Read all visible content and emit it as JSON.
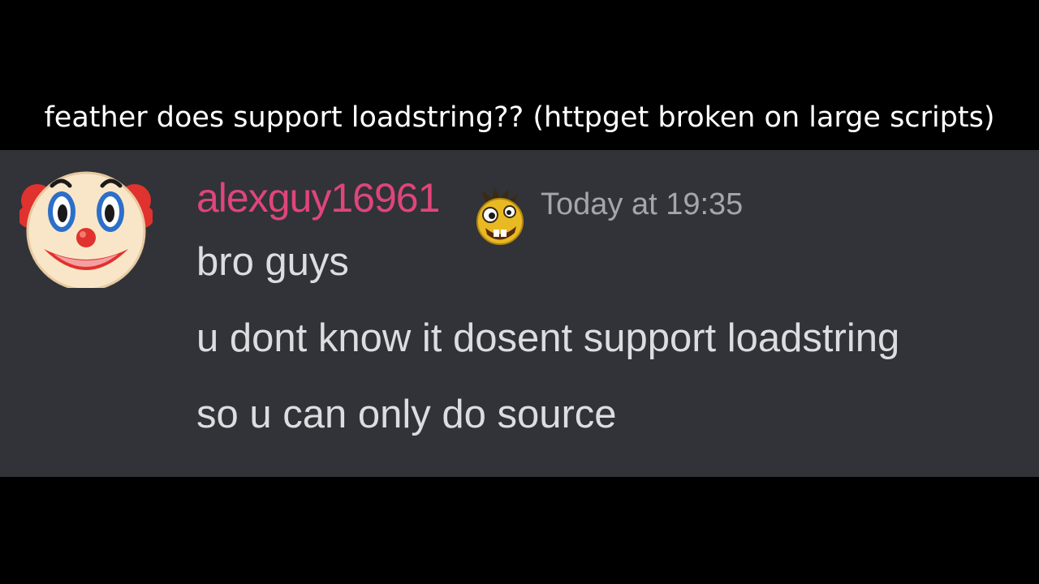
{
  "caption": "feather does support loadstring?? (httpget broken on large scripts)",
  "message": {
    "avatar_icon": "clown-face-icon",
    "username": "alexguy16961",
    "username_color": "#e0457a",
    "badge_icon": "goofy-face-emoji-icon",
    "timestamp": "Today at 19:35",
    "lines": [
      "bro guys",
      "u dont know it dosent support loadstring",
      "so u can only do source"
    ]
  },
  "colors": {
    "background": "#000000",
    "message_background": "#313338",
    "message_text": "#dbdee1",
    "timestamp_text": "#a3a6aa"
  }
}
